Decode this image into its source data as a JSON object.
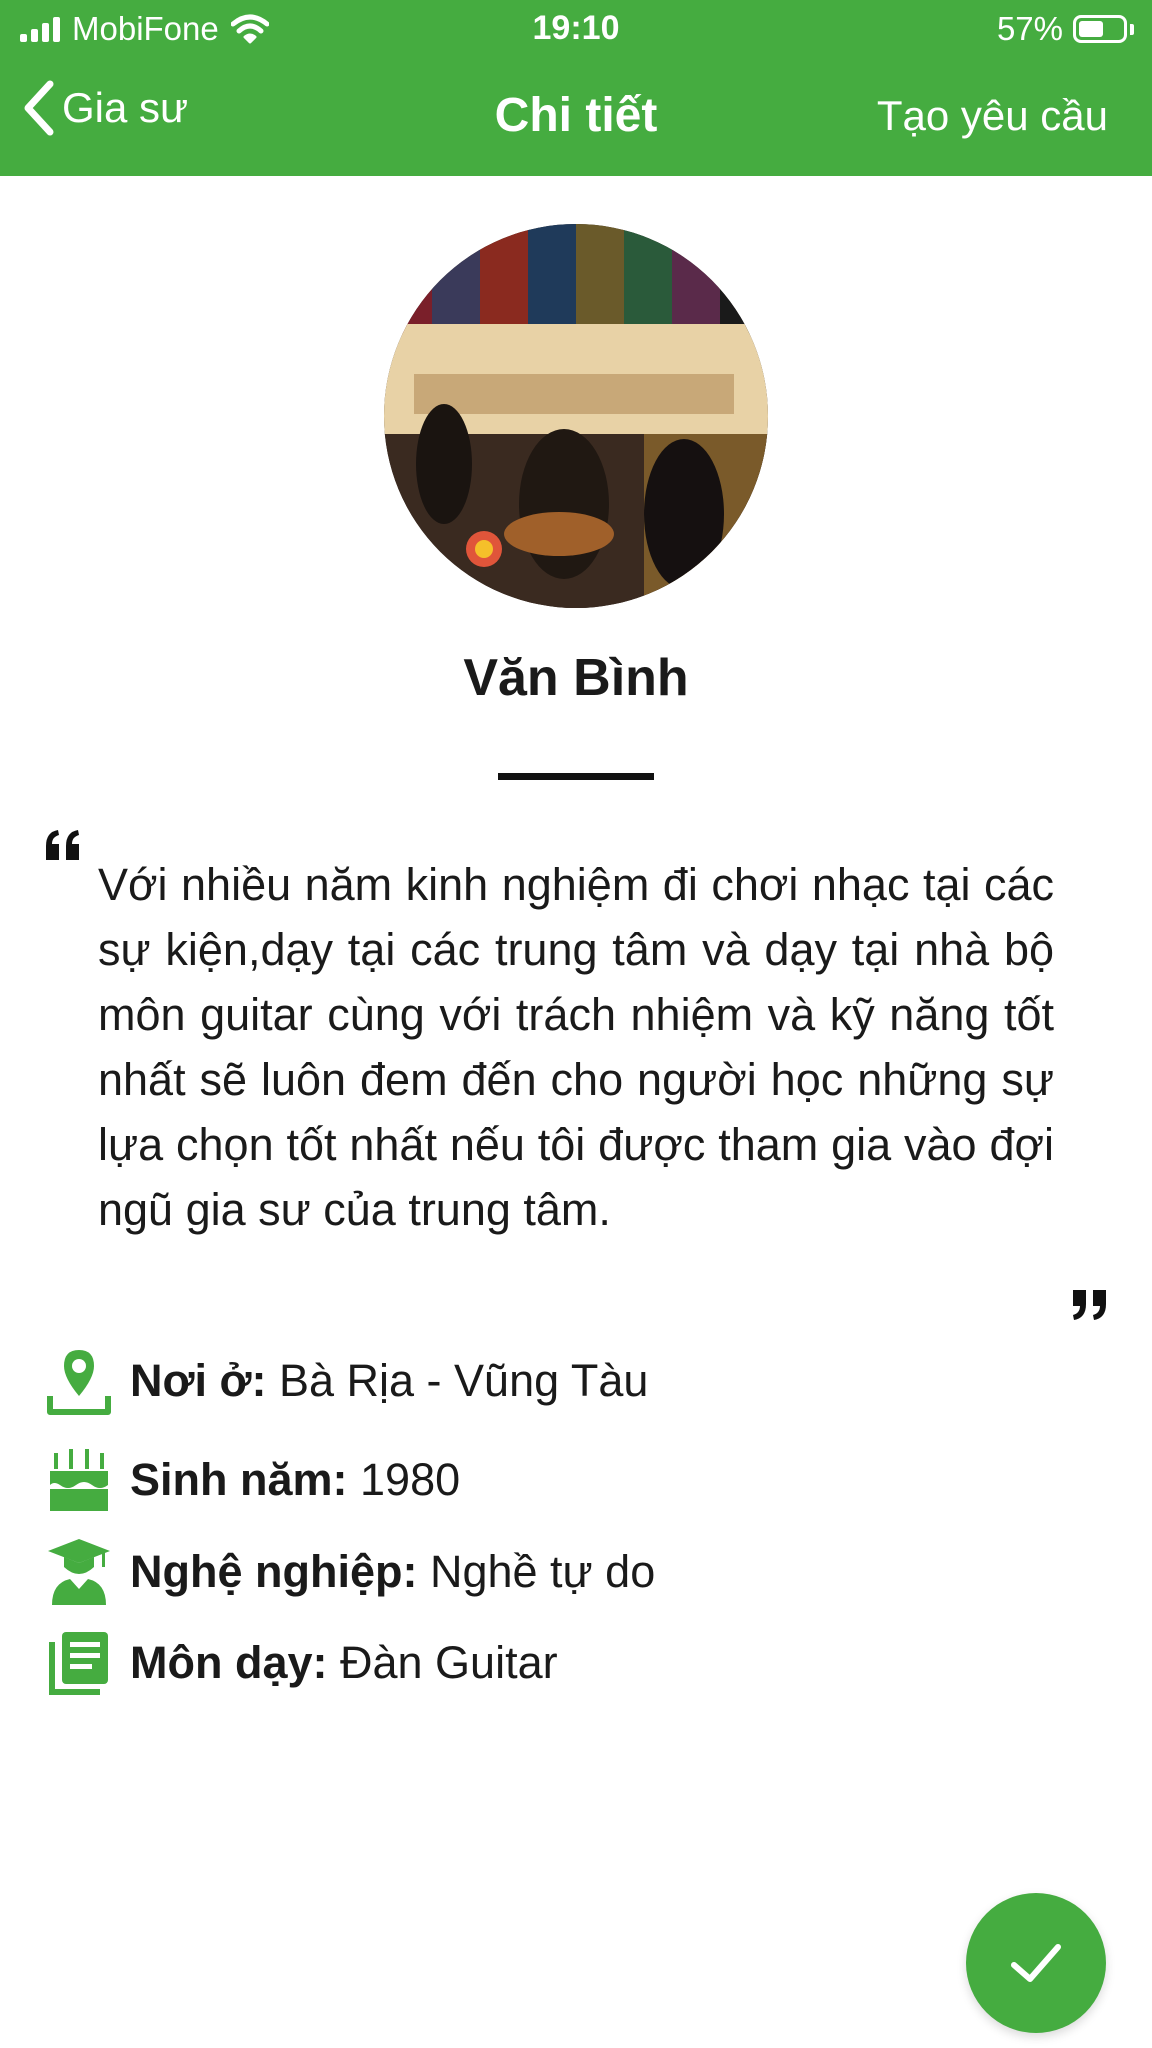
{
  "status_bar": {
    "carrier": "MobiFone",
    "time": "19:10",
    "battery": "57%",
    "battery_level": 0.57
  },
  "nav": {
    "back_label": "Gia sư",
    "title": "Chi tiết",
    "action_label": "Tạo yêu cầu"
  },
  "profile": {
    "name": "Văn Bình",
    "bio": "Với nhiều năm kinh nghiệm đi chơi nhạc tại các sự kiện,dạy tại các trung tâm và dạy tại nhà bộ môn guitar cùng với trách nhiệm và kỹ năng tốt nhất sẽ luôn đem đến cho người học những sự lựa chọn tốt nhất nếu tôi được tham gia vào đợi ngũ gia sư của trung tâm."
  },
  "details": [
    {
      "icon": "location-pin-icon",
      "label": "Nơi ở:",
      "value": " Bà Rịa - Vũng Tàu"
    },
    {
      "icon": "birthday-cake-icon",
      "label": "Sinh năm:",
      "value": " 1980"
    },
    {
      "icon": "graduate-icon",
      "label": "Nghệ nghiệp:",
      "value": " Nghề tự do"
    },
    {
      "icon": "book-icon",
      "label": "Môn dạy:",
      "value": " Đàn Guitar"
    }
  ],
  "colors": {
    "accent": "#45ac40",
    "text": "#1a1a1a"
  }
}
